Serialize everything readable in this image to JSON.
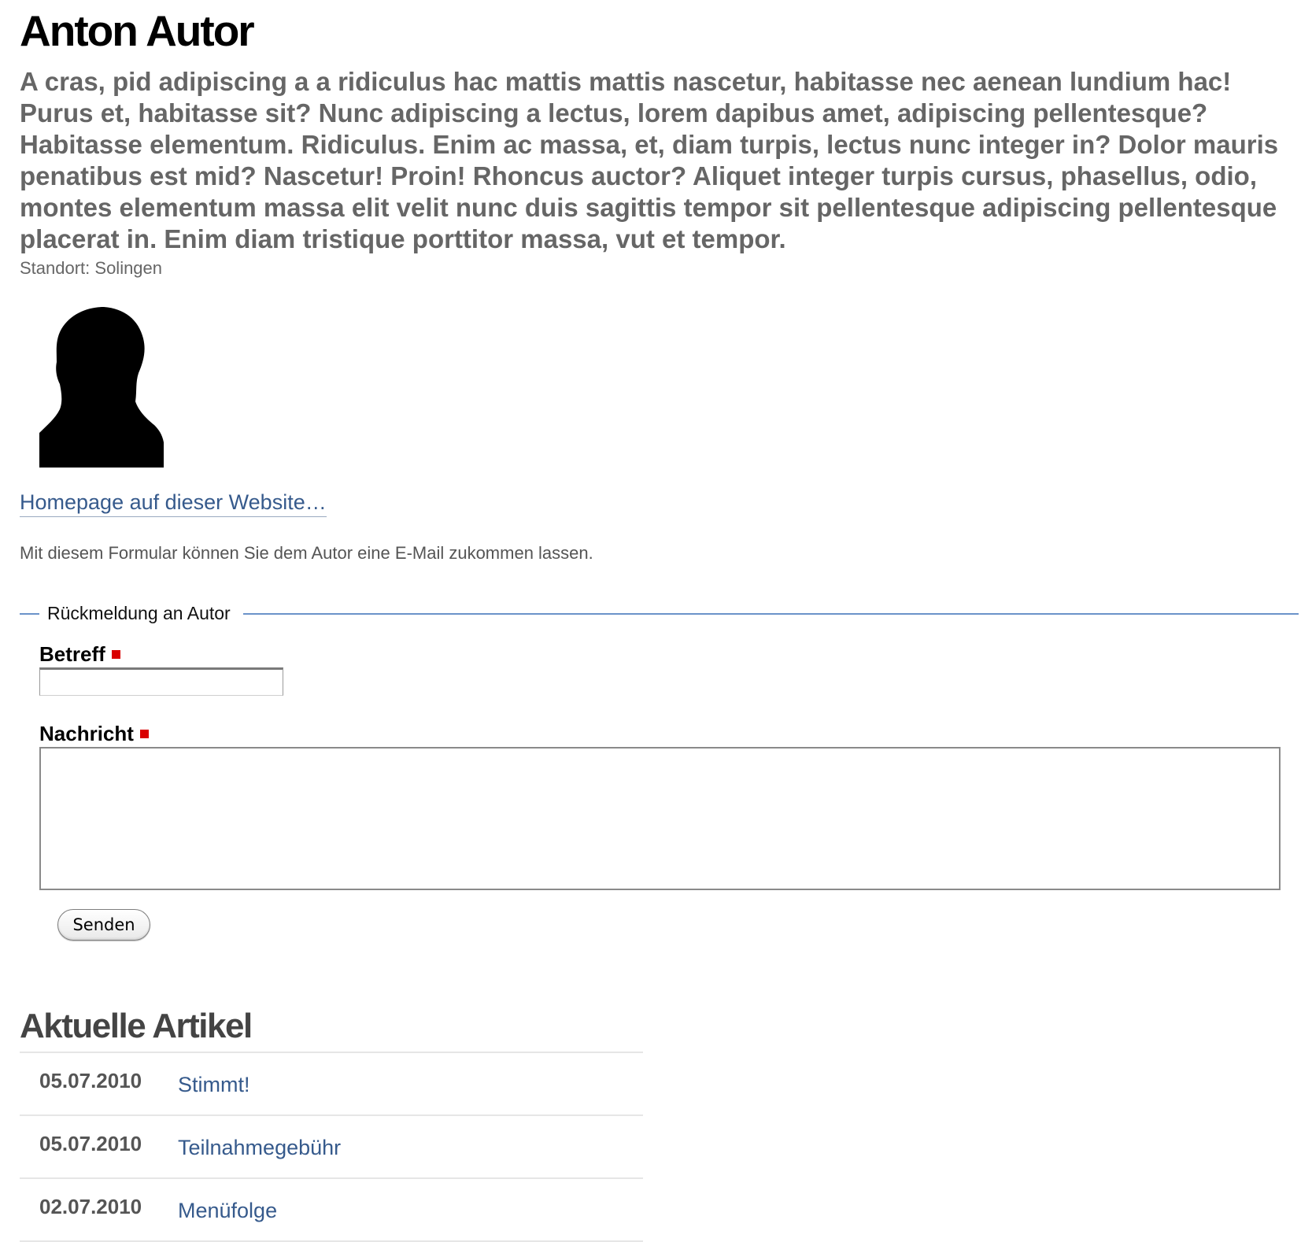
{
  "author": {
    "name": "Anton Autor",
    "bio": "A cras, pid adipiscing a a ridiculus hac mattis mattis nascetur, habitasse nec aenean lundium hac! Purus et, habitasse sit? Nunc adipiscing a lectus, lorem dapibus amet, adipiscing pellentesque? Habitasse elementum. Ridiculus. Enim ac massa, et, diam turpis, lectus nunc integer in? Dolor mauris penatibus est mid? Nascetur! Proin! Rhoncus auctor? Aliquet integer turpis cursus, phasellus, odio, montes elementum massa elit velit nunc duis sagittis tempor sit pellentesque adipiscing pellentesque placerat in. Enim diam tristique porttitor massa, vut et tempor.",
    "location": "Standort: Solingen",
    "avatar_icon": "person-silhouette-icon",
    "homepage_link": "Homepage auf dieser Website…"
  },
  "form": {
    "intro": "Mit diesem Formular können Sie dem Autor eine E-Mail zukommen lassen.",
    "legend": "Rückmeldung an Autor",
    "subject_label": "Betreff",
    "subject_value": "",
    "message_label": "Nachricht",
    "message_value": "",
    "required_marker_color": "#d90000",
    "submit_label": "Senden"
  },
  "articles": {
    "title": "Aktuelle Artikel",
    "items": [
      {
        "date": "05.07.2010",
        "title": "Stimmt!"
      },
      {
        "date": "05.07.2010",
        "title": "Teilnahmegebühr"
      },
      {
        "date": "02.07.2010",
        "title": "Menüfolge"
      }
    ]
  },
  "colors": {
    "link": "#365a8c",
    "fieldset_border": "#6b93c9",
    "lead_text": "#666666"
  }
}
